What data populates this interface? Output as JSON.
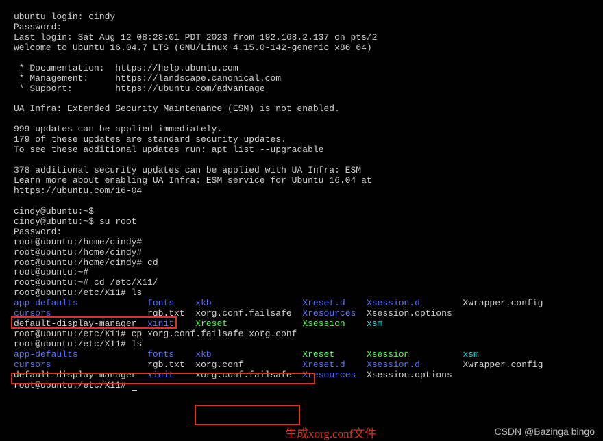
{
  "lines": {
    "login": "ubuntu login: cindy",
    "pwd": "Password:",
    "lastlogin": "Last login: Sat Aug 12 08:28:01 PDT 2023 from 192.168.2.137 on pts/2",
    "welcome": "Welcome to Ubuntu 16.04.7 LTS (GNU/Linux 4.15.0-142-generic x86_64)",
    "doc": " * Documentation:  https://help.ubuntu.com",
    "mgmt": " * Management:     https://landscape.canonical.com",
    "support": " * Support:        https://ubuntu.com/advantage",
    "esm1": "UA Infra: Extended Security Maintenance (ESM) is not enabled.",
    "upd1": "999 updates can be applied immediately.",
    "upd2": "179 of these updates are standard security updates.",
    "upd3": "To see these additional updates run: apt list --upgradable",
    "esm2": "378 additional security updates can be applied with UA Infra: ESM",
    "esm3": "Learn more about enabling UA Infra: ESM service for Ubuntu 16.04 at",
    "esm4": "https://ubuntu.com/16-04",
    "p1": "cindy@ubuntu:~$",
    "p2": "cindy@ubuntu:~$ su root",
    "p3": "Password:",
    "p4": "root@ubuntu:/home/cindy#",
    "p5": "root@ubuntu:/home/cindy#",
    "p6": "root@ubuntu:/home/cindy# cd",
    "p7": "root@ubuntu:~#",
    "p8": "root@ubuntu:~# cd /etc/X11/",
    "p9": "root@ubuntu:/etc/X11# ls",
    "p10": "root@ubuntu:/etc/X11# cp xorg.conf.failsafe xorg.conf",
    "p11": "root@ubuntu:/etc/X11# ls",
    "p12": "root@ubuntu:/etc/X11# "
  },
  "ls1": {
    "r1c1": "app-defaults",
    "r1c2": "fonts",
    "r1c3": "xkb",
    "r1c4": "Xreset.d",
    "r1c5": "Xsession.d",
    "r1c6": "Xwrapper.config",
    "r2c1": "cursors",
    "r2c2": "rgb.txt",
    "r2c3": "xorg.conf.failsafe",
    "r2c4": "Xresources",
    "r2c5": "Xsession.options",
    "r3c1": "default-display-manager",
    "r3c2": "xinit",
    "r3c3": "Xreset",
    "r3c4": "Xsession",
    "r3c5": "xsm"
  },
  "ls2": {
    "r1c1": "app-defaults",
    "r1c2": "fonts",
    "r1c3": "xkb",
    "r1c4": "Xreset",
    "r1c5": "Xsession",
    "r1c6": "xsm",
    "r2c1": "cursors",
    "r2c2": "rgb.txt",
    "r2c3": "xorg.conf",
    "r2c4": "Xreset.d",
    "r2c5": "Xsession.d",
    "r2c6": "Xwrapper.config",
    "r3c1": "default-display-manager",
    "r3c2": "xinit",
    "r3c3": "xorg.conf.failsafe",
    "r3c4": "Xresources",
    "r3c5": "Xsession.options"
  },
  "caption": "生成xorg.conf文件",
  "watermark": "CSDN @Bazinga bingo"
}
